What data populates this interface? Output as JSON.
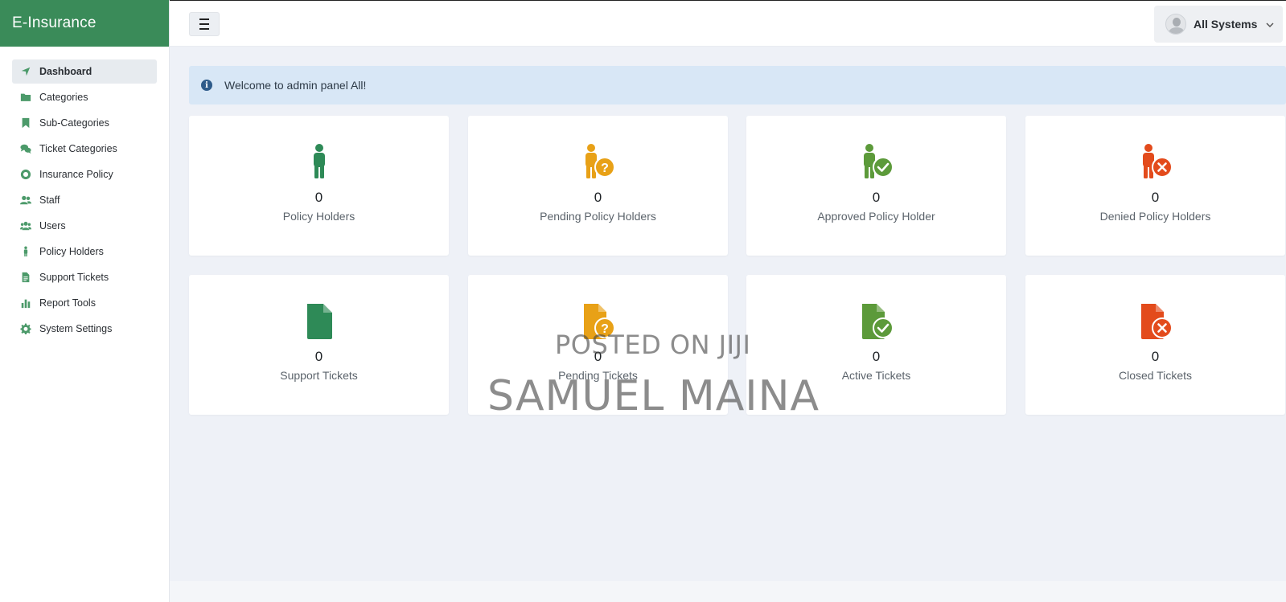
{
  "brand": {
    "title": "E-Insurance",
    "color": "#3a8b59"
  },
  "topbar": {
    "menu_icon": "hamburger-icon",
    "user": {
      "name": "All Systems",
      "avatar_icon": "user-avatar",
      "chevron_icon": "chevron-down-icon"
    }
  },
  "sidebar": {
    "items": [
      {
        "label": "Dashboard",
        "icon": "location-arrow-icon",
        "active": true
      },
      {
        "label": "Categories",
        "icon": "folder-icon"
      },
      {
        "label": "Sub-Categories",
        "icon": "bookmark-icon"
      },
      {
        "label": "Ticket Categories",
        "icon": "comments-icon"
      },
      {
        "label": "Insurance Policy",
        "icon": "life-ring-icon"
      },
      {
        "label": "Staff",
        "icon": "user-group-icon"
      },
      {
        "label": "Users",
        "icon": "users-icon"
      },
      {
        "label": "Policy Holders",
        "icon": "person-icon"
      },
      {
        "label": "Support Tickets",
        "icon": "file-icon"
      },
      {
        "label": "Report Tools",
        "icon": "bar-chart-icon"
      },
      {
        "label": "System Settings",
        "icon": "gear-icon"
      }
    ]
  },
  "alert": {
    "text": "Welcome to admin panel All!",
    "icon": "info-circle-icon"
  },
  "cards": [
    {
      "count": "0",
      "label": "Policy Holders",
      "icon": "person-icon",
      "color": "#2e8a57"
    },
    {
      "count": "0",
      "label": "Pending Policy Holders",
      "icon": "person-question-icon",
      "color": "#e8a117"
    },
    {
      "count": "0",
      "label": "Approved Policy Holder",
      "icon": "person-check-icon",
      "color": "#5c9a3a"
    },
    {
      "count": "0",
      "label": "Denied Policy Holders",
      "icon": "person-x-icon",
      "color": "#e34b1c"
    },
    {
      "count": "0",
      "label": "Support Tickets",
      "icon": "file-icon",
      "color": "#2e8a57"
    },
    {
      "count": "0",
      "label": "Pending Tickets",
      "icon": "file-question-icon",
      "color": "#e8a117"
    },
    {
      "count": "0",
      "label": "Active Tickets",
      "icon": "file-check-icon",
      "color": "#5c9a3a"
    },
    {
      "count": "0",
      "label": "Closed Tickets",
      "icon": "file-x-icon",
      "color": "#e34b1c"
    }
  ],
  "watermark": {
    "line1": "POSTED ON JIJI",
    "line2": "SAMUEL MAINA"
  }
}
